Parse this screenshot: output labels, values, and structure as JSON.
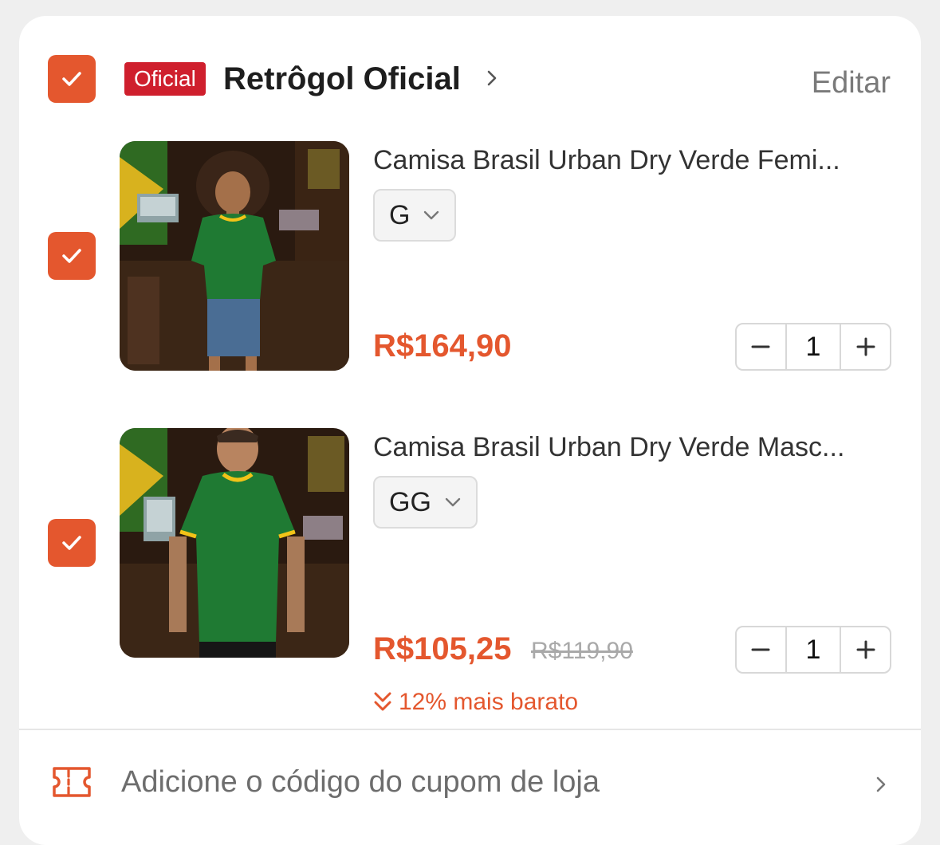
{
  "store": {
    "badge": "Oficial",
    "name": "Retrôgol Oficial",
    "edit_label": "Editar"
  },
  "products": [
    {
      "title": "Camisa Brasil Urban Dry Verde Femi...",
      "variant": "G",
      "price": "R$164,90",
      "quantity": "1"
    },
    {
      "title": "Camisa Brasil Urban Dry Verde Masc...",
      "variant": "GG",
      "price": "R$105,25",
      "old_price": "R$119,90",
      "discount": "12% mais barato",
      "quantity": "1"
    }
  ],
  "coupon": {
    "label": "Adicione o código do cupom de loja"
  },
  "colors": {
    "accent": "#e4572e",
    "official_badge": "#cf1f2d",
    "jersey_green": "#1f7a33",
    "jersey_trim": "#f2c318"
  },
  "icons": {
    "checkbox": "checkmark-icon",
    "chevron": "chevron-right-icon",
    "dropdown": "chevron-down-icon",
    "minus": "minus-icon",
    "plus": "plus-icon",
    "discount": "double-chevron-down-icon",
    "coupon": "ticket-icon"
  }
}
